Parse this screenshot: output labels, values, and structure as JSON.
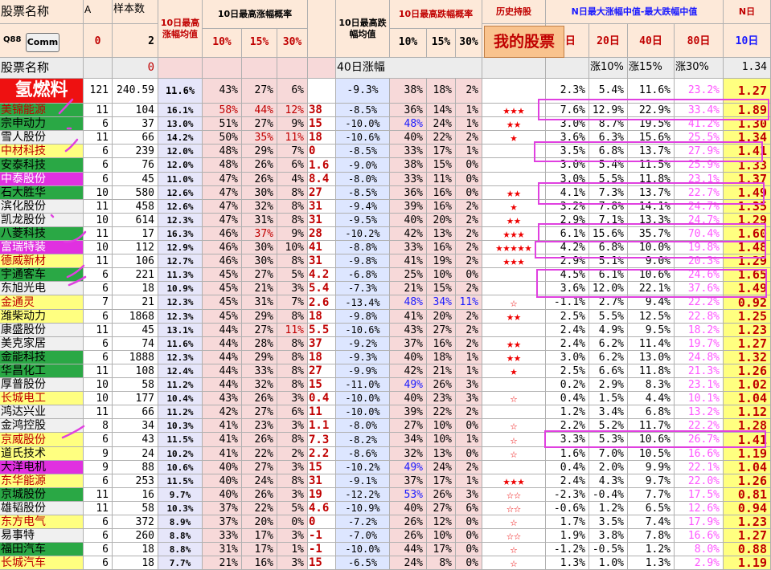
{
  "header": {
    "name": "股票名称",
    "colA": "A",
    "sample": "样本数",
    "avgRise10": "10日最高涨幅均值",
    "probRise10": "10日最高涨幅概率",
    "avgFall10": "10日最高跌幅均值",
    "probFall10": "10日最高跌幅概率",
    "history": "历史持股",
    "nDays": "N日最大涨幅中值-最大跌幅中值",
    "nLabel": "N日",
    "p10": "10%",
    "p15": "15%",
    "p30": "30%",
    "q10": "10%",
    "q15": "15%",
    "q30": "30%",
    "d10": "0日",
    "d20": "20日",
    "d40": "40日",
    "d80": "80日",
    "dd10": "10日",
    "code": "Q88",
    "comm_label": "Comm",
    "zero": "0",
    "two": "2",
    "mystock_label": "我的股票"
  },
  "row3": {
    "name": "股票名称",
    "zero": "0",
    "d40": "40日涨幅",
    "u10": "涨10%",
    "u15": "涨15%",
    "u30": "涨30%",
    "val": "1.34"
  },
  "featured": {
    "name": "氢燃料",
    "a": "121",
    "s": "240.59",
    "avg": "11.6%",
    "p10": "43%",
    "p15": "27%",
    "p30": "6%",
    "k": "",
    "f": "-9.3%",
    "f10": "38%",
    "f15": "18%",
    "f30": "2%",
    "stars": "",
    "n0": "2.3%",
    "n20": "5.4%",
    "n40": "11.6%",
    "n80": "23.2%",
    "last": "1.27"
  },
  "rows": [
    [
      "美锦能源",
      "11",
      "104",
      "16.1%",
      "58%",
      "44%",
      "12%",
      "38",
      "-8.5%",
      "36%",
      "14%",
      "1%",
      "★★★",
      "7.6%",
      "12.9%",
      "22.9%",
      "33.4%",
      "1.89"
    ],
    [
      "宗申动力",
      "6",
      "37",
      "13.0%",
      "51%",
      "27%",
      "9%",
      "15",
      "-10.0%",
      "48%",
      "24%",
      "1%",
      "★★",
      "3.0%",
      "8.7%",
      "19.5%",
      "41.2%",
      "1.30"
    ],
    [
      "雪人股份",
      "11",
      "66",
      "14.2%",
      "50%",
      "35%",
      "11%",
      "18",
      "-10.6%",
      "40%",
      "22%",
      "2%",
      "★",
      "3.6%",
      "6.3%",
      "15.6%",
      "25.5%",
      "1.34"
    ],
    [
      "中材科技",
      "6",
      "239",
      "12.0%",
      "48%",
      "29%",
      "7%",
      "0",
      "-8.5%",
      "33%",
      "17%",
      "1%",
      "",
      "3.5%",
      "6.8%",
      "13.7%",
      "27.9%",
      "1.41"
    ],
    [
      "安泰科技",
      "6",
      "76",
      "12.0%",
      "48%",
      "26%",
      "6%",
      "1.6",
      "-9.0%",
      "38%",
      "15%",
      "0%",
      "",
      "3.0%",
      "5.4%",
      "11.5%",
      "25.9%",
      "1.33"
    ],
    [
      "中泰股份",
      "6",
      "45",
      "11.0%",
      "47%",
      "26%",
      "4%",
      "8.4",
      "-8.0%",
      "33%",
      "11%",
      "0%",
      "",
      "3.0%",
      "5.5%",
      "11.8%",
      "23.1%",
      "1.37"
    ],
    [
      "石大胜华",
      "10",
      "580",
      "12.6%",
      "47%",
      "30%",
      "8%",
      "27",
      "-8.5%",
      "36%",
      "16%",
      "0%",
      "★★",
      "4.1%",
      "7.3%",
      "13.7%",
      "22.7%",
      "1.49"
    ],
    [
      "滨化股份",
      "11",
      "458",
      "12.6%",
      "47%",
      "32%",
      "8%",
      "31",
      "-9.4%",
      "39%",
      "16%",
      "2%",
      "★",
      "3.2%",
      "7.8%",
      "14.1%",
      "24.7%",
      "1.35"
    ],
    [
      "凯龙股份",
      "10",
      "614",
      "12.3%",
      "47%",
      "31%",
      "8%",
      "31",
      "-9.5%",
      "40%",
      "20%",
      "2%",
      "★★",
      "2.9%",
      "7.1%",
      "13.3%",
      "24.7%",
      "1.29"
    ],
    [
      "八菱科技",
      "11",
      "17",
      "16.3%",
      "46%",
      "37%",
      "9%",
      "28",
      "-10.2%",
      "42%",
      "13%",
      "2%",
      "★★★",
      "6.1%",
      "15.6%",
      "35.7%",
      "70.4%",
      "1.60"
    ],
    [
      "富瑞特装",
      "10",
      "112",
      "12.9%",
      "46%",
      "30%",
      "10%",
      "41",
      "-8.8%",
      "33%",
      "16%",
      "2%",
      "★★★★★",
      "4.2%",
      "6.8%",
      "10.0%",
      "19.8%",
      "1.48"
    ],
    [
      "德威新材",
      "11",
      "106",
      "12.7%",
      "46%",
      "30%",
      "8%",
      "31",
      "-9.8%",
      "41%",
      "19%",
      "2%",
      "★★★",
      "2.9%",
      "5.1%",
      "9.0%",
      "20.3%",
      "1.29"
    ],
    [
      "宇通客车",
      "6",
      "221",
      "11.3%",
      "45%",
      "27%",
      "5%",
      "4.2",
      "-6.8%",
      "25%",
      "10%",
      "0%",
      "",
      "4.5%",
      "6.1%",
      "10.6%",
      "24.6%",
      "1.65"
    ],
    [
      "东旭光电",
      "6",
      "18",
      "10.9%",
      "45%",
      "21%",
      "3%",
      "5.4",
      "-7.3%",
      "21%",
      "15%",
      "2%",
      "",
      "3.6%",
      "12.0%",
      "22.1%",
      "37.6%",
      "1.49"
    ],
    [
      "金通灵",
      "7",
      "21",
      "12.3%",
      "45%",
      "31%",
      "7%",
      "2.6",
      "-13.4%",
      "48%",
      "34%",
      "11%",
      "☆",
      "-1.1%",
      "2.7%",
      "9.4%",
      "22.2%",
      "0.92"
    ],
    [
      "潍柴动力",
      "6",
      "1868",
      "12.3%",
      "45%",
      "29%",
      "8%",
      "18",
      "-9.8%",
      "41%",
      "20%",
      "2%",
      "★★",
      "2.5%",
      "5.5%",
      "12.5%",
      "22.8%",
      "1.25"
    ],
    [
      "康盛股份",
      "11",
      "45",
      "13.1%",
      "44%",
      "27%",
      "11%",
      "5.5",
      "-10.6%",
      "43%",
      "27%",
      "2%",
      "",
      "2.4%",
      "4.9%",
      "9.5%",
      "18.2%",
      "1.23"
    ],
    [
      "美克家居",
      "6",
      "74",
      "11.6%",
      "44%",
      "28%",
      "8%",
      "37",
      "-9.2%",
      "37%",
      "16%",
      "2%",
      "★★",
      "2.4%",
      "6.2%",
      "11.4%",
      "19.7%",
      "1.27"
    ],
    [
      "金能科技",
      "6",
      "1888",
      "12.3%",
      "44%",
      "29%",
      "8%",
      "18",
      "-9.3%",
      "40%",
      "18%",
      "1%",
      "★★",
      "3.0%",
      "6.2%",
      "13.0%",
      "24.8%",
      "1.32"
    ],
    [
      "华昌化工",
      "11",
      "108",
      "12.4%",
      "44%",
      "33%",
      "8%",
      "27",
      "-9.9%",
      "42%",
      "21%",
      "1%",
      "★",
      "2.5%",
      "6.6%",
      "11.8%",
      "21.3%",
      "1.26"
    ],
    [
      "厚普股份",
      "10",
      "58",
      "11.2%",
      "44%",
      "32%",
      "8%",
      "15",
      "-11.0%",
      "49%",
      "26%",
      "3%",
      "",
      "0.2%",
      "2.9%",
      "8.3%",
      "23.1%",
      "1.02"
    ],
    [
      "长城电工",
      "10",
      "177",
      "10.4%",
      "43%",
      "26%",
      "3%",
      "0.4",
      "-10.0%",
      "40%",
      "23%",
      "3%",
      "☆",
      "0.4%",
      "1.5%",
      "4.4%",
      "10.1%",
      "1.04"
    ],
    [
      "鸿达兴业",
      "11",
      "66",
      "11.2%",
      "42%",
      "27%",
      "6%",
      "11",
      "-10.0%",
      "39%",
      "22%",
      "2%",
      "",
      "1.2%",
      "3.4%",
      "6.8%",
      "13.2%",
      "1.12"
    ],
    [
      "金鸿控股",
      "8",
      "34",
      "10.3%",
      "41%",
      "23%",
      "3%",
      "1.1",
      "-8.0%",
      "27%",
      "10%",
      "0%",
      "☆",
      "2.2%",
      "5.2%",
      "11.7%",
      "22.2%",
      "1.28"
    ],
    [
      "京威股份",
      "6",
      "43",
      "11.5%",
      "41%",
      "26%",
      "8%",
      "7.3",
      "-8.2%",
      "34%",
      "10%",
      "1%",
      "☆",
      "3.3%",
      "5.3%",
      "10.6%",
      "26.7%",
      "1.41"
    ],
    [
      "道氏技术",
      "9",
      "24",
      "10.2%",
      "41%",
      "22%",
      "2%",
      "2.2",
      "-8.6%",
      "32%",
      "13%",
      "0%",
      "☆",
      "1.6%",
      "7.0%",
      "10.5%",
      "16.6%",
      "1.19"
    ],
    [
      "大洋电机",
      "9",
      "88",
      "10.6%",
      "40%",
      "27%",
      "3%",
      "15",
      "-10.2%",
      "49%",
      "24%",
      "2%",
      "",
      "0.4%",
      "2.0%",
      "9.9%",
      "22.1%",
      "1.04"
    ],
    [
      "东华能源",
      "6",
      "253",
      "11.5%",
      "40%",
      "24%",
      "8%",
      "31",
      "-9.1%",
      "37%",
      "17%",
      "1%",
      "★★★",
      "2.4%",
      "4.3%",
      "9.7%",
      "22.0%",
      "1.26"
    ],
    [
      "京城股份",
      "11",
      "16",
      "9.7%",
      "40%",
      "26%",
      "3%",
      "19",
      "-12.2%",
      "53%",
      "26%",
      "3%",
      "☆☆",
      "-2.3%",
      "-0.4%",
      "7.7%",
      "17.5%",
      "0.81"
    ],
    [
      "雄韬股份",
      "11",
      "58",
      "10.3%",
      "37%",
      "22%",
      "5%",
      "4.6",
      "-10.9%",
      "40%",
      "27%",
      "6%",
      "☆☆",
      "-0.6%",
      "1.2%",
      "6.5%",
      "12.6%",
      "0.94"
    ],
    [
      "东方电气",
      "6",
      "372",
      "8.9%",
      "37%",
      "20%",
      "0%",
      "0",
      "-7.2%",
      "26%",
      "12%",
      "0%",
      "☆",
      "1.7%",
      "3.5%",
      "7.4%",
      "17.9%",
      "1.23"
    ],
    [
      "易事特",
      "6",
      "260",
      "8.8%",
      "33%",
      "17%",
      "3%",
      "-1",
      "-7.0%",
      "26%",
      "10%",
      "0%",
      "☆☆",
      "1.9%",
      "3.8%",
      "7.8%",
      "16.6%",
      "1.27"
    ],
    [
      "福田汽车",
      "6",
      "18",
      "8.8%",
      "31%",
      "17%",
      "1%",
      "-1",
      "-10.0%",
      "44%",
      "17%",
      "0%",
      "☆",
      "-1.2%",
      "-0.5%",
      "1.2%",
      "8.0%",
      "0.88"
    ],
    [
      "长城汽车",
      "6",
      "18",
      "7.7%",
      "21%",
      "16%",
      "3%",
      "15",
      "-6.5%",
      "24%",
      "8%",
      "0%",
      "☆",
      "1.3%",
      "1.0%",
      "1.3%",
      "2.9%",
      "1.19"
    ]
  ],
  "styles": {
    "name_bg": [
      "#2aa845",
      "#2aa845",
      "#f0f0f0",
      "#ffff80",
      "#2aa845",
      "#e030e0",
      "#2aa845",
      "#f0f0f0",
      "#f0f0f0",
      "#2aa845",
      "#e030e0",
      "#ffff80",
      "#2aa845",
      "#f0f0f0",
      "#ffff80",
      "#ffff80",
      "#f0f0f0",
      "#f0f0f0",
      "#2aa845",
      "#2aa845",
      "#f0f0f0",
      "#ffff80",
      "#f0f0f0",
      "#f0f0f0",
      "#ffff80",
      "#ffff80",
      "#e030e0",
      "#ffff80",
      "#2aa845",
      "#f0f0f0",
      "#ffff80",
      "#f0f0f0",
      "#2aa845",
      "#ffff80"
    ],
    "name_fg": [
      "#c00000",
      "#000000",
      "#000000",
      "#c00000",
      "#000000",
      "#ffffff",
      "#000000",
      "#000000",
      "#000000",
      "#000000",
      "#ffffff",
      "#c00000",
      "#000000",
      "#000000",
      "#c00000",
      "#000000",
      "#000000",
      "#000000",
      "#000000",
      "#000000",
      "#000000",
      "#c00000",
      "#000000",
      "#000000",
      "#c00000",
      "#000000",
      "#000000",
      "#c00000",
      "#000000",
      "#000000",
      "#c00000",
      "#000000",
      "#000000",
      "#c00000"
    ],
    "red_p10": [
      0
    ],
    "red_p15": [
      0,
      2,
      9
    ],
    "red_p30": [
      0,
      2,
      16
    ],
    "blue_f10": [
      1,
      14,
      20,
      26,
      28
    ],
    "blue_f15": [
      14
    ],
    "blue_f30": [
      14
    ],
    "accent_red": "#c00000",
    "accent_blue": "#1a1aff",
    "overlay_color": "#e040e0"
  }
}
